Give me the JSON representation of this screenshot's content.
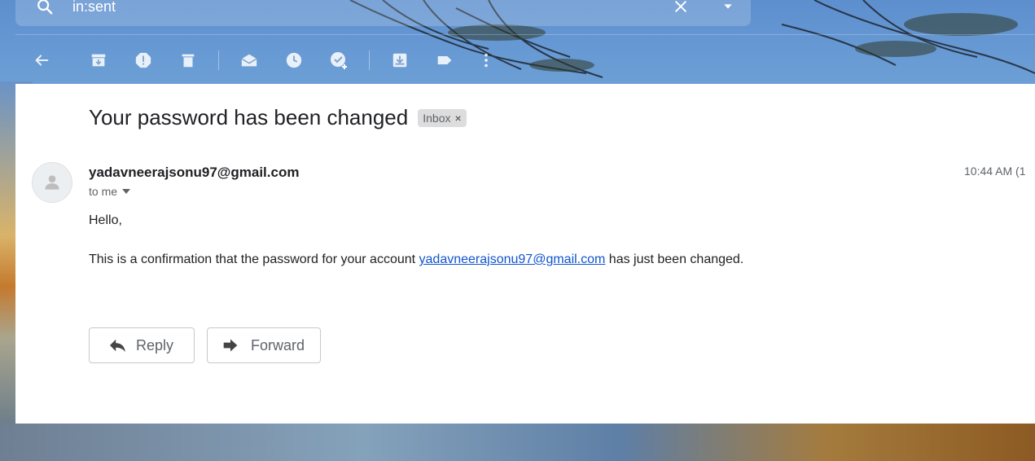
{
  "search": {
    "value": "in:sent",
    "icon": "search-icon"
  },
  "toolbar": {
    "icons": [
      "back-arrow-icon",
      "archive-icon",
      "report-spam-icon",
      "delete-icon",
      "mark-unread-icon",
      "snooze-icon",
      "add-task-icon",
      "move-to-icon",
      "label-icon",
      "more-vert-icon"
    ]
  },
  "email": {
    "subject": "Your password has been changed",
    "label": "Inbox",
    "label_close": "×",
    "sender": "yadavneerajsonu97@gmail.com",
    "to": "to me",
    "time": "10:44 AM (1",
    "greeting": "Hello,",
    "body_prefix": "This is a confirmation that the password for your account ",
    "body_link": "yadavneerajsonu97@gmail.com",
    "body_suffix": " has just been changed."
  },
  "actions": {
    "reply": "Reply",
    "forward": "Forward"
  },
  "colors": {
    "link": "#1155cc",
    "chip_bg": "#dddddd",
    "text": "#202124"
  }
}
